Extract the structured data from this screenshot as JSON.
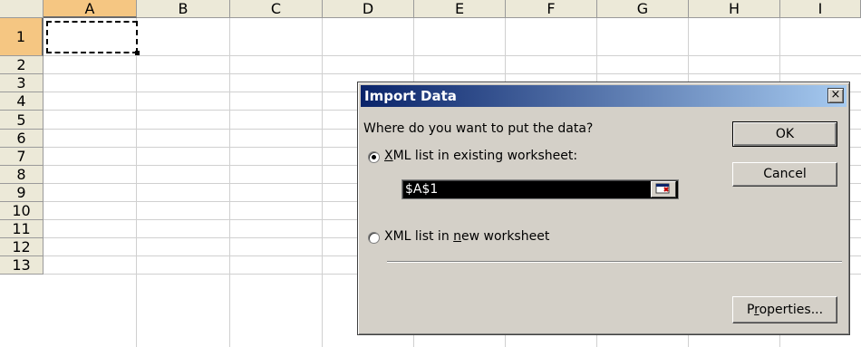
{
  "sheet": {
    "columns": [
      "A",
      "B",
      "C",
      "D",
      "E",
      "F",
      "G",
      "H",
      "I"
    ],
    "rows": [
      "1",
      "2",
      "3",
      "4",
      "5",
      "6",
      "7",
      "8",
      "9",
      "10",
      "11",
      "12",
      "13"
    ]
  },
  "dialog": {
    "title": "Import Data",
    "close_label": "×",
    "question": "Where do you want to put the data?",
    "option_existing": {
      "prefix": "",
      "mnemonic": "X",
      "suffix": "ML list in existing worksheet:",
      "selected": true
    },
    "range_value": "$A$1",
    "option_new": {
      "prefix": "XML list in ",
      "mnemonic": "n",
      "suffix": "ew worksheet",
      "selected": false
    },
    "ok_label": "OK",
    "cancel_label": "Cancel",
    "properties": {
      "prefix": "P",
      "mnemonic": "r",
      "suffix": "operties..."
    }
  }
}
